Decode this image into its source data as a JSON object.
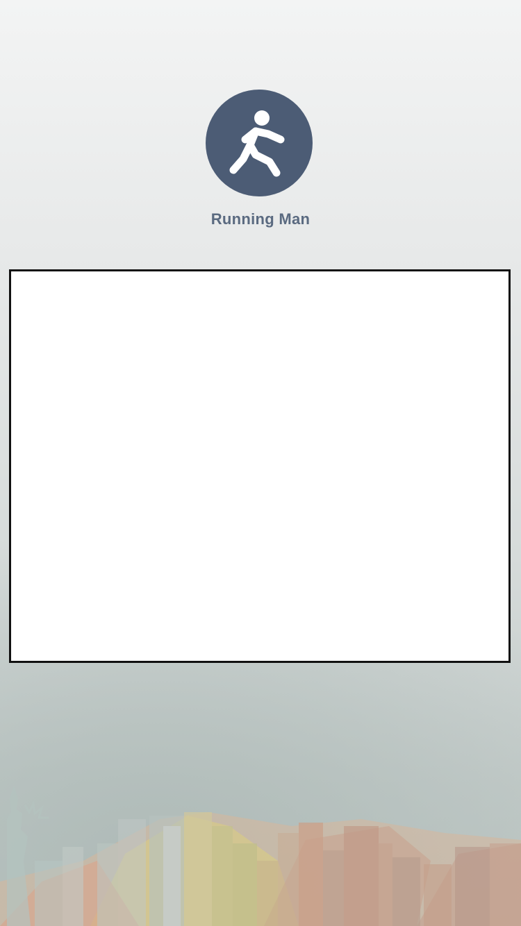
{
  "app": {
    "name": "Running Man",
    "logo_icon": "running-man-icon",
    "logo_color": "#4c5c75"
  },
  "panel": {
    "background": "#ffffff",
    "border": "#111111"
  },
  "decoration": {
    "footer_art": "city-skyline-illustration"
  }
}
